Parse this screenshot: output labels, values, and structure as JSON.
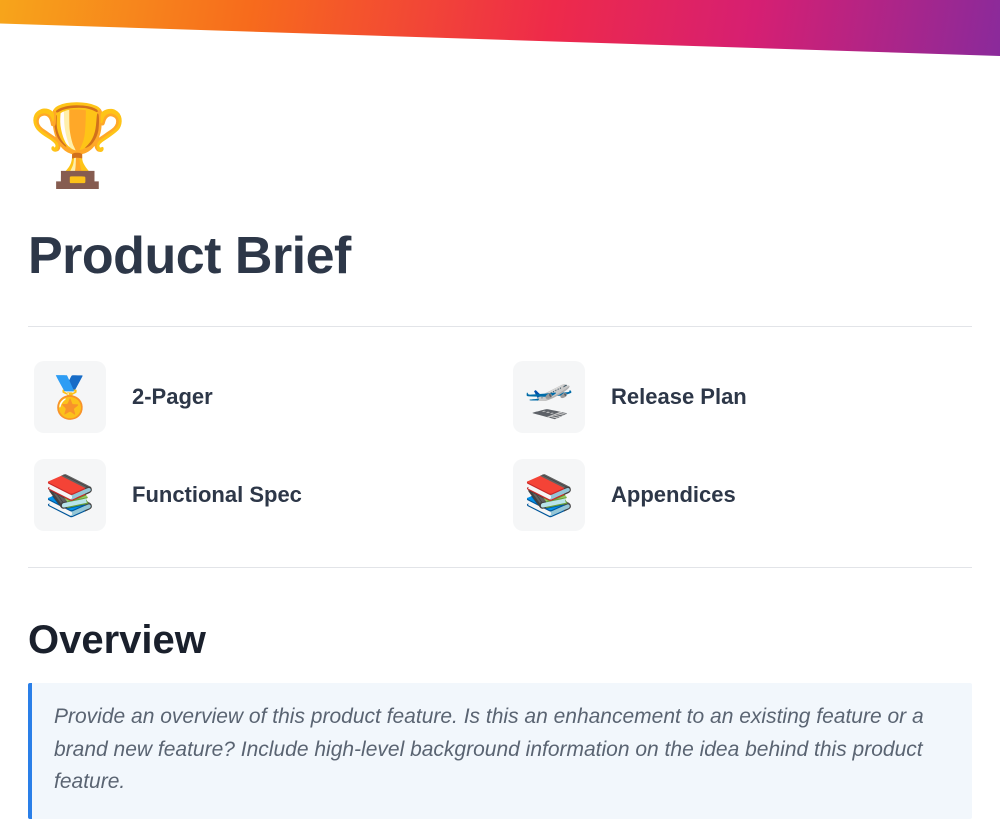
{
  "page": {
    "icon": "🏆",
    "title": "Product Brief"
  },
  "nav": {
    "items": [
      {
        "icon": "🏅",
        "label": "2-Pager"
      },
      {
        "icon": "🛫",
        "label": "Release Plan"
      },
      {
        "icon": "📚",
        "label": "Functional Spec"
      },
      {
        "icon": "📚",
        "label": "Appendices"
      }
    ]
  },
  "section": {
    "title": "Overview",
    "callout": "Provide an overview of this product feature. Is this an enhancement to an existing feature or a brand new feature? Include high-level background information on the idea behind this product feature."
  }
}
